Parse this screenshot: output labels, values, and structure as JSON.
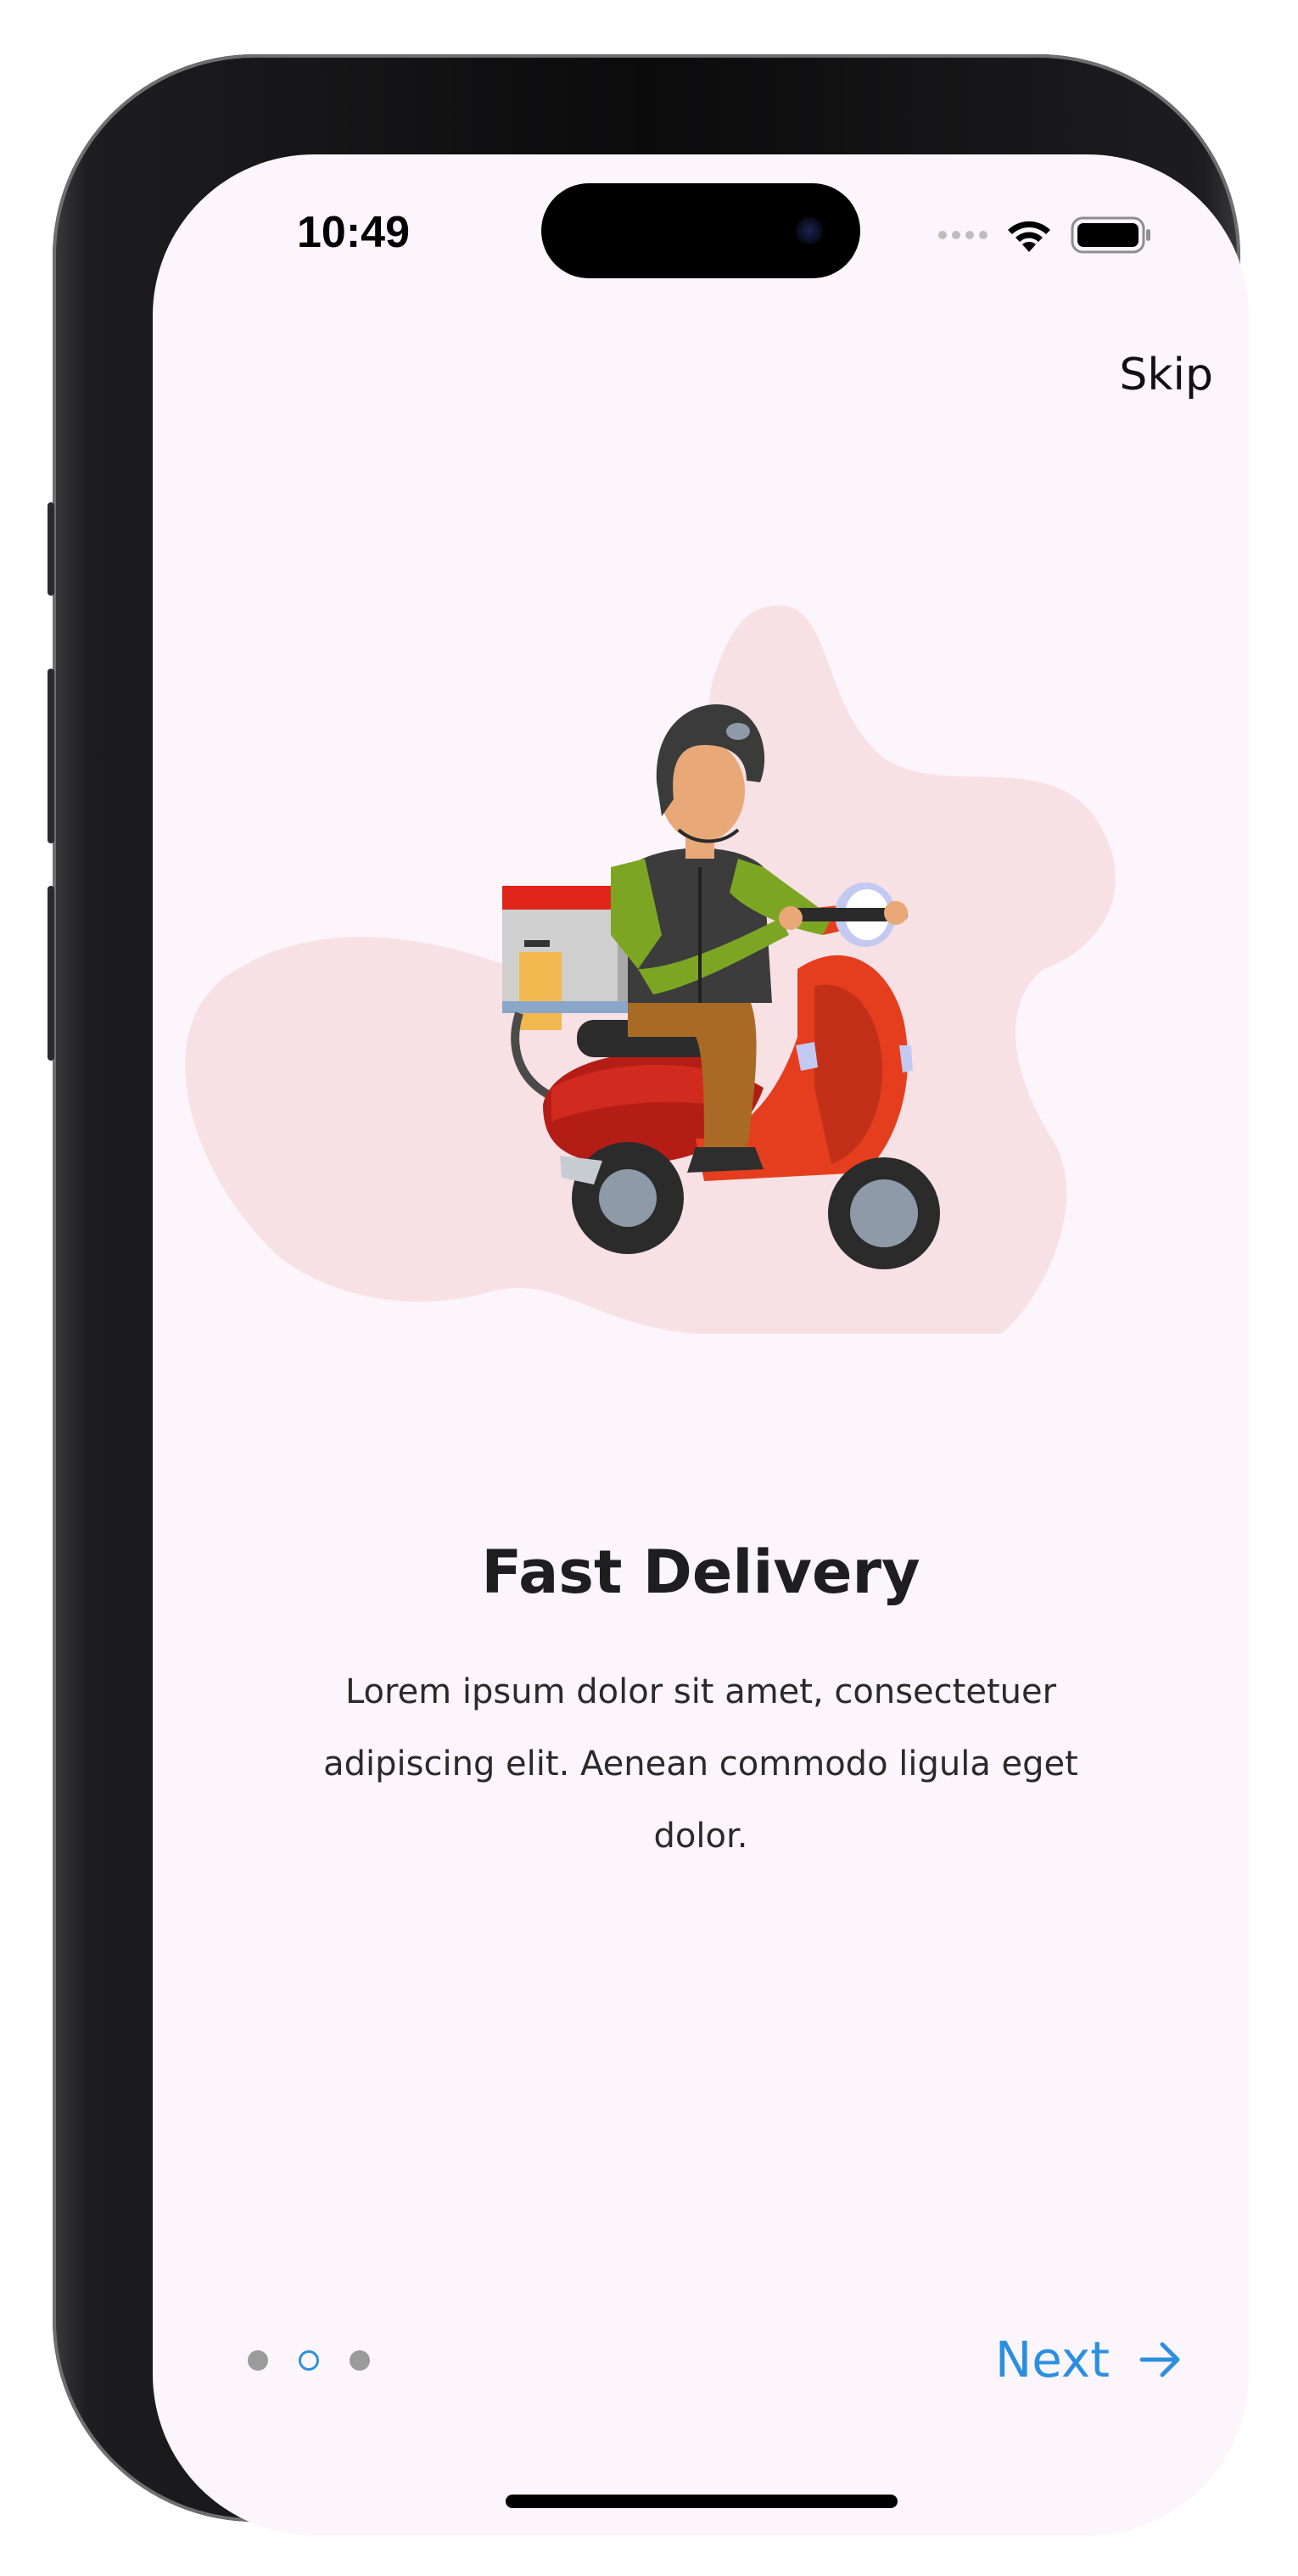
{
  "status_bar": {
    "time": "10:49"
  },
  "onboarding": {
    "skip_label": "Skip",
    "title": "Fast Delivery",
    "description": "Lorem ipsum dolor sit amet, consectetuer adipiscing elit. Aenean commodo ligula eget dolor.",
    "next_label": "Next",
    "page_indicator": {
      "total": 3,
      "current": 2
    }
  },
  "colors": {
    "background": "#fcf5fc",
    "accent": "#2b8fe0",
    "blob": "#f7e1e4",
    "scooter": "#e53e1e"
  },
  "icons": {
    "next": "arrow-right-icon",
    "wifi": "wifi-icon",
    "battery": "battery-icon"
  }
}
